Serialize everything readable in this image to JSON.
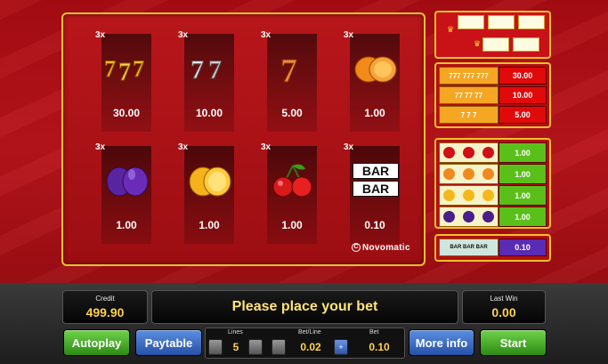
{
  "paytable": {
    "symbols": [
      {
        "name": "triple-seven",
        "mult": "3x",
        "pay": "30.00"
      },
      {
        "name": "double-seven",
        "mult": "3x",
        "pay": "10.00"
      },
      {
        "name": "seven",
        "mult": "3x",
        "pay": "5.00"
      },
      {
        "name": "orange",
        "mult": "3x",
        "pay": "1.00"
      },
      {
        "name": "plum",
        "mult": "3x",
        "pay": "1.00"
      },
      {
        "name": "lemon",
        "mult": "3x",
        "pay": "1.00"
      },
      {
        "name": "cherry",
        "mult": "3x",
        "pay": "1.00"
      },
      {
        "name": "bar-bar",
        "mult": "3x",
        "pay": "0.10"
      }
    ],
    "bar_text": "BAR",
    "logo": "Novomatic",
    "logo_mark": "C"
  },
  "side_panel": {
    "sevens": [
      {
        "icons": "777 777 777",
        "value": "30.00"
      },
      {
        "icons": "77 77 77",
        "value": "10.00"
      },
      {
        "icons": "7 7 7",
        "value": "5.00"
      }
    ],
    "fruits": [
      {
        "fruit": "cherry",
        "color": "#d01015",
        "value": "1.00"
      },
      {
        "fruit": "orange",
        "color": "#f08a1e",
        "value": "1.00"
      },
      {
        "fruit": "lemon",
        "color": "#f5b81a",
        "value": "1.00"
      },
      {
        "fruit": "plum",
        "color": "#4a1d8a",
        "value": "1.00"
      }
    ],
    "bar": {
      "icons": "BAR BAR BAR",
      "value": "0.10"
    }
  },
  "console": {
    "credit_label": "Credit",
    "credit_value": "499.90",
    "message": "Please place your bet",
    "lastwin_label": "Last Win",
    "lastwin_value": "0.00",
    "autoplay": "Autoplay",
    "paytable": "Paytable",
    "lines_label": "Lines",
    "lines_value": "5",
    "betline_label": "Bet/Line",
    "betline_value": "0.02",
    "bet_label": "Bet",
    "bet_value": "0.10",
    "more_info": "More info",
    "start": "Start"
  },
  "colors": {
    "accent_gold": "#f2c12e",
    "background_red": "#a80c12",
    "display_yellow": "#ffd14a"
  }
}
